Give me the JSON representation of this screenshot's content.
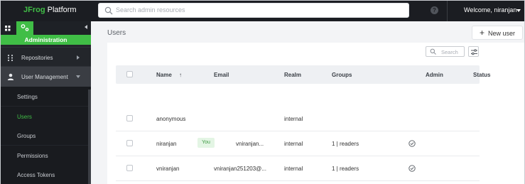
{
  "topbar": {
    "brand_prefix": "JFrog",
    "brand_suffix": "Platform",
    "search_placeholder": "Search admin resources",
    "help_icon": "?",
    "welcome": "Welcome, niranjan"
  },
  "sidebar": {
    "section_title": "Administration",
    "nav": [
      {
        "label": "Repositories",
        "icon": "repositories-icon"
      },
      {
        "label": "User Management",
        "icon": "user-icon"
      }
    ],
    "subitems": [
      {
        "label": "Settings"
      },
      {
        "label": "Users",
        "active": true
      },
      {
        "label": "Groups"
      },
      {
        "label": "Permissions"
      },
      {
        "label": "Access Tokens"
      }
    ]
  },
  "main": {
    "title": "Users",
    "new_user_label": "New user",
    "search_placeholder": "Search",
    "columns": {
      "name": "Name",
      "name_sort": "↑",
      "email": "Email",
      "realm": "Realm",
      "groups": "Groups",
      "admin": "Admin",
      "status": "Status"
    },
    "rows": [
      {
        "name": "anonymous",
        "you": "",
        "email": "",
        "realm": "internal",
        "groups": "",
        "admin": false
      },
      {
        "name": "niranjan",
        "you": "You",
        "email": "vniranjan...",
        "realm": "internal",
        "groups": "1 | readers",
        "admin": true
      },
      {
        "name": "vniranjan",
        "you": "",
        "email": "vniranjan251203@...",
        "realm": "internal",
        "groups": "1 | readers",
        "admin": true
      }
    ]
  },
  "colors": {
    "accent": "#40be46",
    "topbar": "#1b1d22",
    "sidebar": "#23262b"
  }
}
